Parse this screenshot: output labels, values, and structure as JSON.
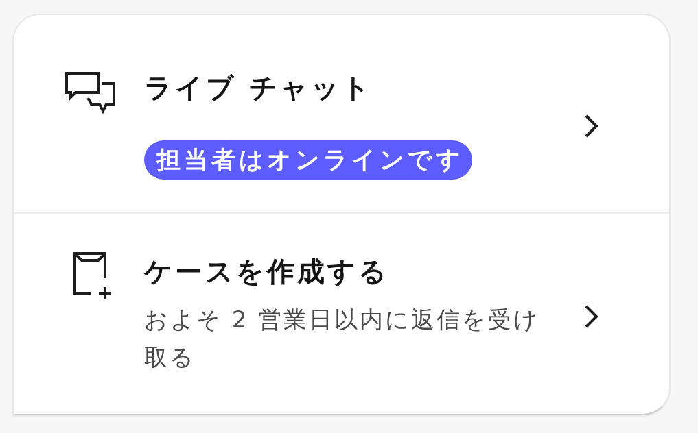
{
  "options": [
    {
      "kind": "chat",
      "title": "ライブ チャット",
      "badge": "担当者はオンラインです"
    },
    {
      "kind": "case",
      "title": "ケースを作成する",
      "description": "およそ 2 営業日以内に返信を受け取る"
    }
  ]
}
